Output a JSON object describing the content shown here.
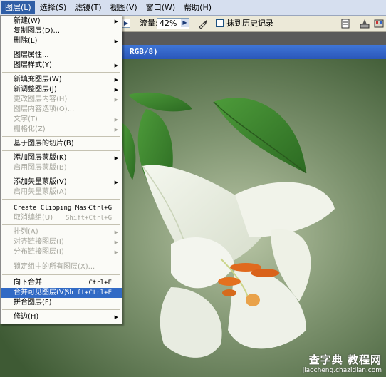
{
  "menubar": {
    "items": [
      {
        "label": "图层(L)",
        "active": true
      },
      {
        "label": "选择(S)"
      },
      {
        "label": "滤镜(T)"
      },
      {
        "label": "视图(V)"
      },
      {
        "label": "窗口(W)"
      },
      {
        "label": "帮助(H)"
      }
    ]
  },
  "options_bar": {
    "flow_label": "流量:",
    "flow_value": "42%",
    "history_checkbox_label": "抹到历史记录",
    "history_checked": false
  },
  "document": {
    "title_fragment": "RGB/8)"
  },
  "layer_menu": {
    "items": [
      {
        "label": "新建(W)",
        "submenu": true
      },
      {
        "label": "复制图层(D)..."
      },
      {
        "label": "删除(L)",
        "submenu": true
      },
      {
        "label": "图层属性..."
      },
      {
        "label": "图层样式(Y)",
        "submenu": true
      },
      {
        "label": "新填充图层(W)",
        "submenu": true
      },
      {
        "label": "新调整图层(J)",
        "submenu": true
      },
      {
        "label": "更改图层内容(H)",
        "submenu": true,
        "disabled": true
      },
      {
        "label": "图层内容选项(O)...",
        "disabled": true
      },
      {
        "label": "文字(T)",
        "submenu": true,
        "disabled": true
      },
      {
        "label": "栅格化(Z)",
        "submenu": true,
        "disabled": true
      },
      {
        "label": "基于图层的切片(B)"
      },
      {
        "label": "添加图层蒙版(K)",
        "submenu": true
      },
      {
        "label": "启用图层蒙版(B)",
        "disabled": true
      },
      {
        "label": "添加矢量蒙版(V)",
        "submenu": true
      },
      {
        "label": "启用矢量蒙版(A)",
        "disabled": true
      },
      {
        "label": "Create Clipping Mask",
        "shortcut": "Ctrl+G"
      },
      {
        "label": "取消编组(U)",
        "shortcut": "Shift+Ctrl+G",
        "disabled": true
      },
      {
        "label": "排列(A)",
        "submenu": true,
        "disabled": true
      },
      {
        "label": "对齐链接图层(I)",
        "submenu": true,
        "disabled": true
      },
      {
        "label": "分布链接图层(I)",
        "submenu": true,
        "disabled": true
      },
      {
        "label": "锁定组中的所有图层(X)...",
        "disabled": true
      },
      {
        "label": "向下合并",
        "shortcut": "Ctrl+E"
      },
      {
        "label": "合并可见图层(V)",
        "shortcut": "Shift+Ctrl+E",
        "highlighted": true
      },
      {
        "label": "拼合图层(F)"
      },
      {
        "label": "修边(H)",
        "submenu": true
      }
    ]
  },
  "watermark": {
    "line1": "查字典 教程网",
    "line2": "jiaocheng.chazidian.com"
  },
  "colors": {
    "menu_highlight": "#316ac5",
    "title_bar": "#2a57b9",
    "disabled_text": "#a5a59c"
  }
}
